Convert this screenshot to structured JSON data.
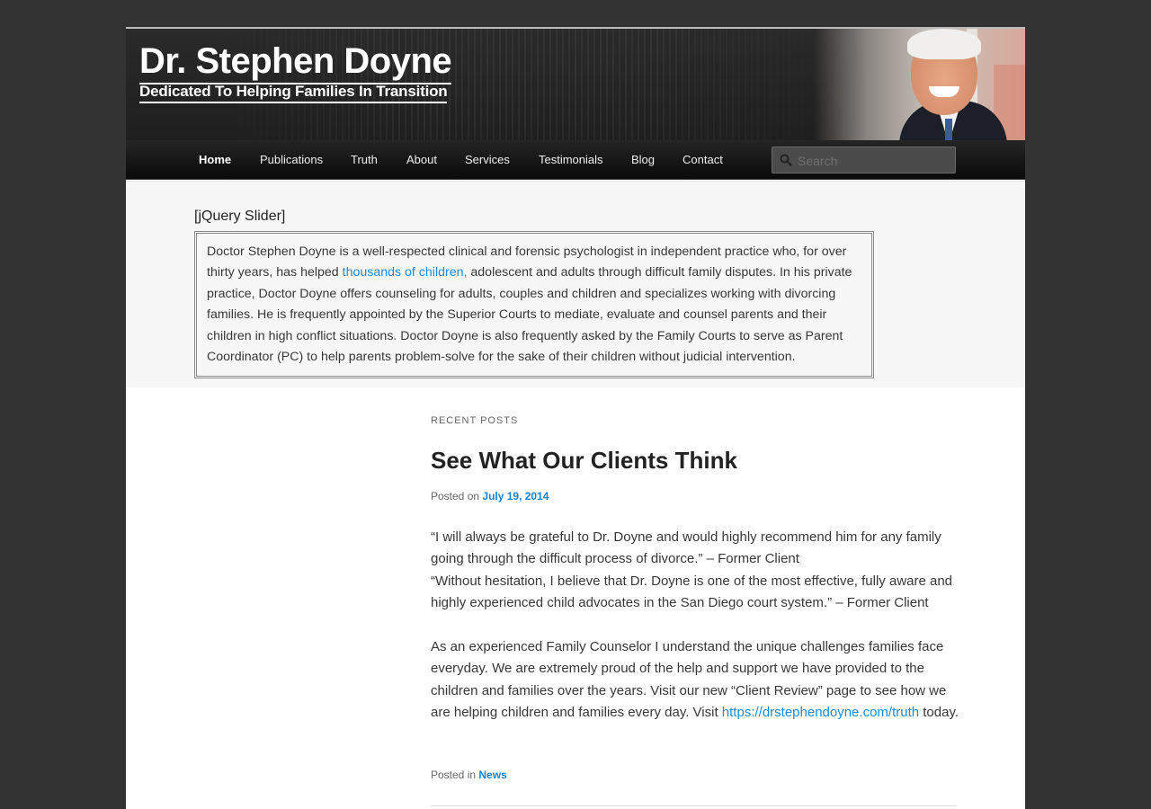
{
  "header": {
    "site_title": "Dr. Stephen Doyne",
    "tagline": "Dedicated To Helping Families In Transition"
  },
  "nav": {
    "items": [
      "Home",
      "Publications",
      "Truth",
      "About",
      "Services",
      "Testimonials",
      "Blog",
      "Contact"
    ],
    "current": "Home",
    "search_placeholder": "Search"
  },
  "showcase": {
    "slider_label": "[jQuery Slider]",
    "intro_before_link": "Doctor Stephen Doyne is a well-respected clinical and forensic psychologist in independent practice who, for over thirty years, has helped ",
    "intro_link": "thousands of children,",
    "intro_after_link": " adolescent and adults through difficult family disputes. In his private practice, Doctor Doyne offers counseling for adults, couples and children and specializes working with divorcing families. He is frequently appointed by the Superior Courts to mediate, evaluate and counsel parents and their children in high conflict situations. Doctor Doyne is also frequently asked by the Family Courts to serve as Parent Coordinator (PC) to help parents problem-solve for the sake of their children without judicial intervention."
  },
  "main": {
    "recent_posts_label": "Recent Posts",
    "post": {
      "title": "See What Our Clients Think",
      "posted_on_label": "Posted on",
      "date": "July 19, 2014",
      "quote1": "“I will always be grateful to Dr. Doyne and would highly recommend him for any family going through the difficult process of divorce.” – Former Client",
      "quote2": "“Without hesitation, I believe that Dr. Doyne is one of the most effective, fully aware and highly experienced child advocates in the San Diego court system.” – Former Client",
      "body_before_link": "As an experienced Family Counselor I understand the unique challenges families face everyday. We are extremely proud of the help and support we have provided to the children and families over the years. Visit our new “Client Review” page to see how we are helping children and families every day. Visit ",
      "body_link": "https://drstephendoyne.com/truth",
      "body_after_link": " today.",
      "posted_in_label": "Posted in",
      "category": "News"
    }
  },
  "colors": {
    "page_background": "#333333",
    "link_blue": "#1982d1"
  }
}
